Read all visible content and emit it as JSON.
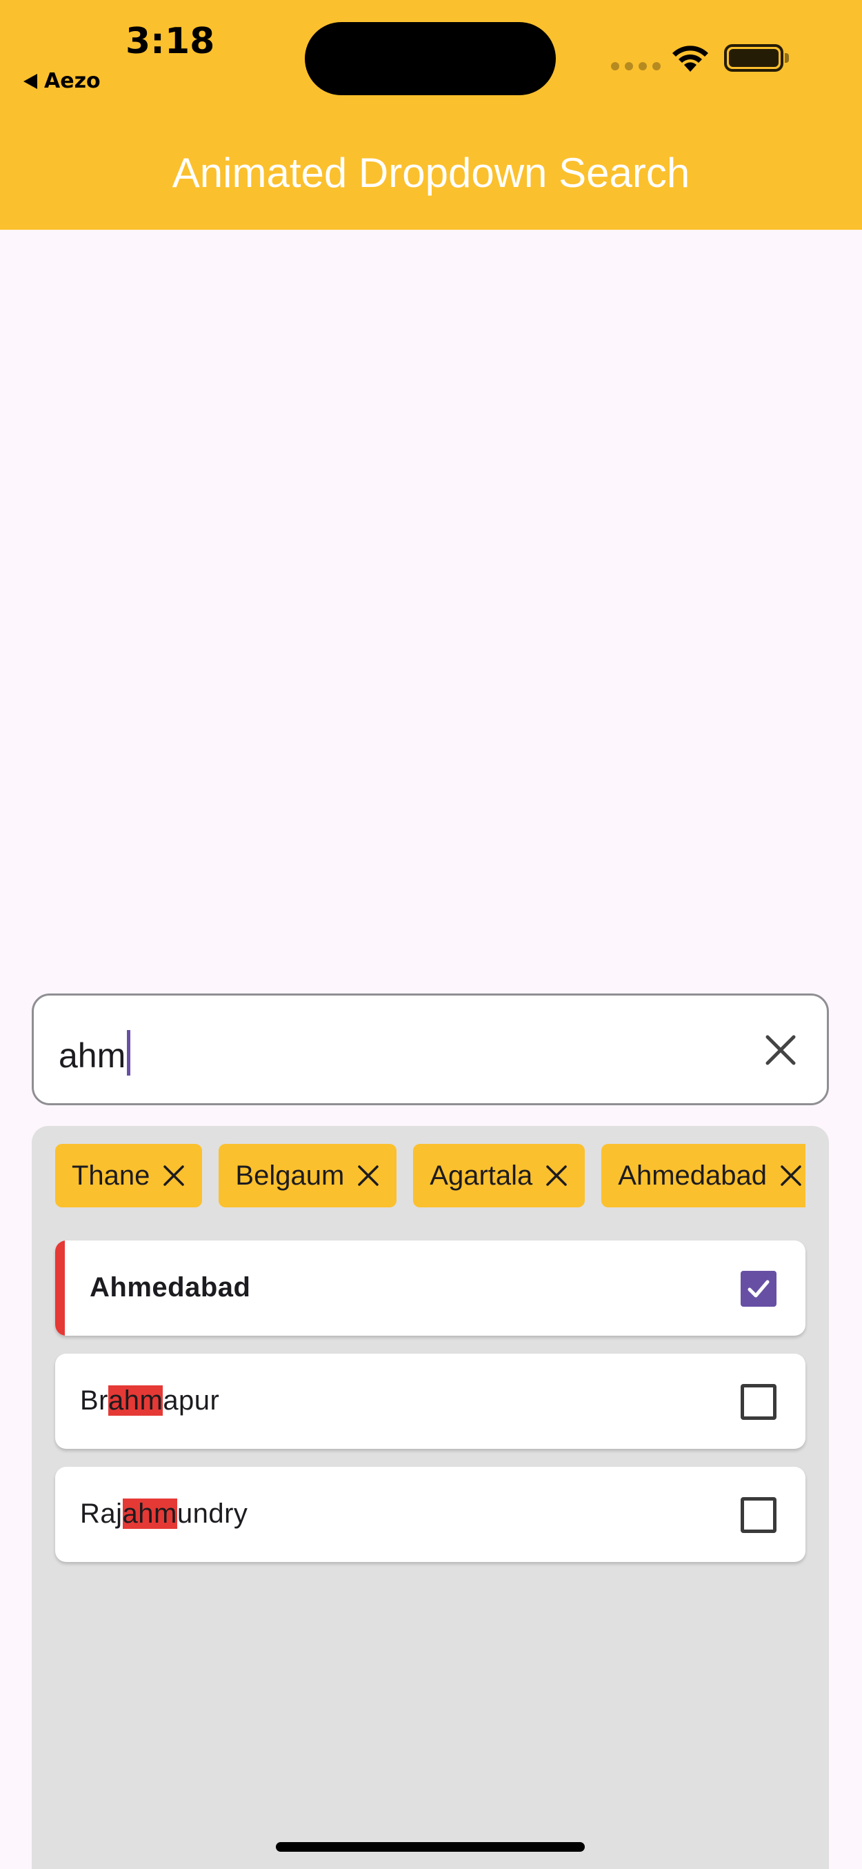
{
  "status_bar": {
    "time": "3:18",
    "back_label": "Aezo"
  },
  "app_bar": {
    "title": "Animated Dropdown Search",
    "color": "#FBC02D"
  },
  "search": {
    "value": "ahm",
    "clear_icon": "close-icon"
  },
  "selected_chips": [
    {
      "label": "Thane"
    },
    {
      "label": "Belgaum"
    },
    {
      "label": "Agartala"
    },
    {
      "label": "Ahmedabad"
    }
  ],
  "results": [
    {
      "pre": "",
      "match": "",
      "post": "",
      "full": "Ahmedabad",
      "checked": true
    },
    {
      "pre": "Br",
      "match": "ahm",
      "post": "apur",
      "full": "",
      "checked": false
    },
    {
      "pre": "Raj",
      "match": "ahm",
      "post": "undry",
      "full": "",
      "checked": false
    }
  ],
  "colors": {
    "accent": "#6750A4",
    "highlight": "#E53935",
    "dropdown_bg": "#E0E0E0"
  }
}
